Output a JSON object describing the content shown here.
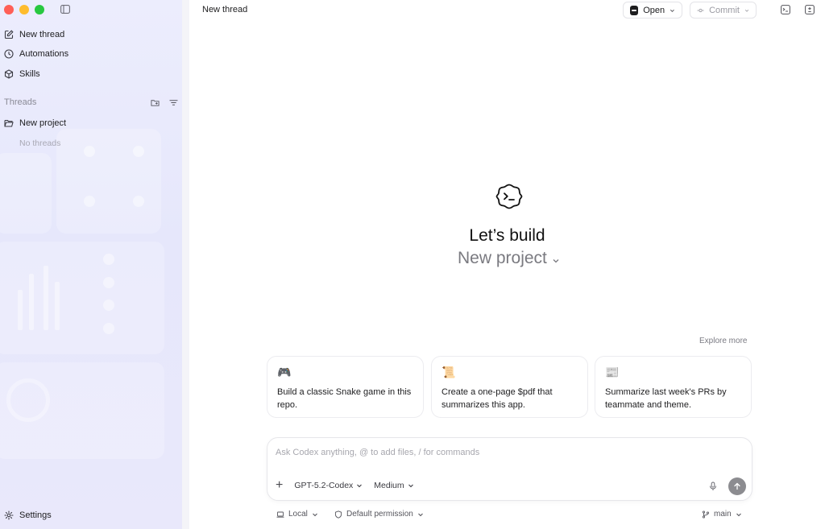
{
  "sidebar": {
    "nav": [
      {
        "label": "New thread",
        "icon": "compose-icon"
      },
      {
        "label": "Automations",
        "icon": "clock-icon"
      },
      {
        "label": "Skills",
        "icon": "cube-icon"
      }
    ],
    "threads_title": "Threads",
    "project_label": "New project",
    "empty_text": "No threads",
    "settings_label": "Settings"
  },
  "header": {
    "title": "New thread",
    "open_label": "Open",
    "commit_label": "Commit"
  },
  "hero": {
    "title": "Let’s build",
    "project": "New project"
  },
  "suggestions": {
    "explore_label": "Explore more",
    "cards": [
      {
        "icon": "🎮",
        "icon_name": "gamepad-icon",
        "text": "Build a classic Snake game in this repo."
      },
      {
        "icon": "📜",
        "icon_name": "scroll-icon",
        "text": "Create a one-page $pdf that summarizes this app."
      },
      {
        "icon": "📰",
        "icon_name": "newspaper-icon",
        "text": "Summarize last week's PRs by teammate and theme."
      }
    ]
  },
  "composer": {
    "placeholder": "Ask Codex anything, @ to add files, / for commands",
    "add_label": "+",
    "model": "GPT-5.2-Codex",
    "effort": "Medium"
  },
  "footer": {
    "env": "Local",
    "permission": "Default permission",
    "branch": "main"
  },
  "colors": {
    "sidebar_bg": "#e8e8fc",
    "traffic_red": "#ff5f57",
    "traffic_yellow": "#febc2e",
    "traffic_green": "#28c840",
    "send_button": "#8c8c90"
  }
}
